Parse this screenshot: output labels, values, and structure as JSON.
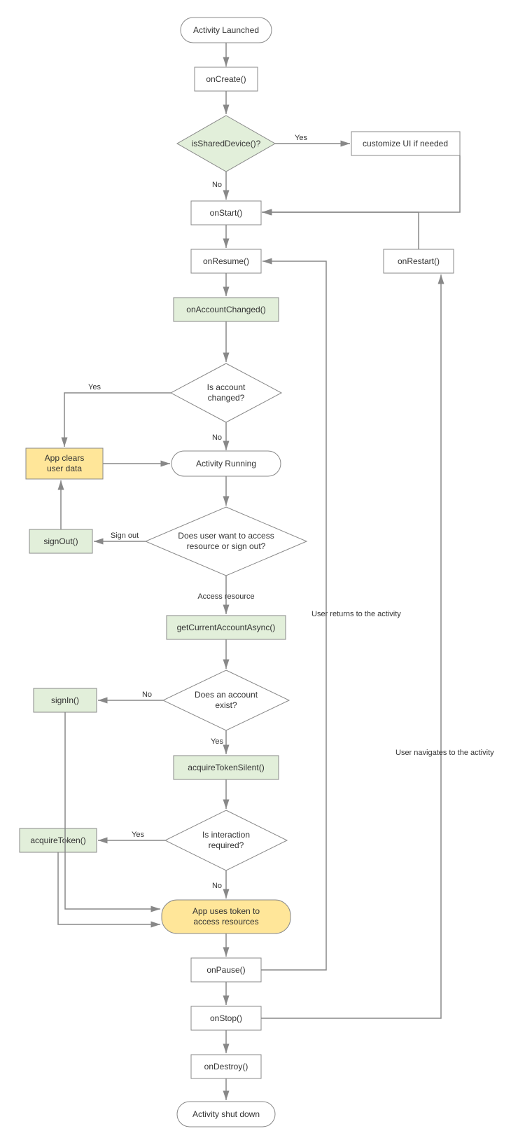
{
  "nodes": {
    "activity_launched": "Activity Launched",
    "on_create": "onCreate()",
    "is_shared_device": "isSharedDevice()?",
    "customize_ui": "customize UI if needed",
    "on_start": "onStart()",
    "on_resume": "onResume()",
    "on_restart": "onRestart()",
    "on_account_changed": "onAccountChanged()",
    "is_account_changed_l1": "Is account",
    "is_account_changed_l2": "changed?",
    "app_clears_l1": "App clears",
    "app_clears_l2": "user data",
    "activity_running": "Activity Running",
    "sign_out": "signOut()",
    "user_want_l1": "Does user want to access",
    "user_want_l2": "resource or sign out?",
    "get_current_account": "getCurrentAccountAsync()",
    "sign_in": "signIn()",
    "account_exist_l1": "Does an account",
    "account_exist_l2": "exist?",
    "acquire_token_silent": "acquireTokenSilent()",
    "acquire_token": "acquireToken()",
    "interaction_l1": "Is interaction",
    "interaction_l2": "required?",
    "app_uses_l1": "App uses token to",
    "app_uses_l2": "access resources",
    "on_pause": "onPause()",
    "on_stop": "onStop()",
    "on_destroy": "onDestroy()",
    "activity_shutdown": "Activity shut down"
  },
  "edges": {
    "yes": "Yes",
    "no": "No",
    "sign_out": "Sign out",
    "access_resource": "Access resource",
    "user_returns": "User returns to the activity",
    "user_navigates": "User navigates to the activity"
  }
}
